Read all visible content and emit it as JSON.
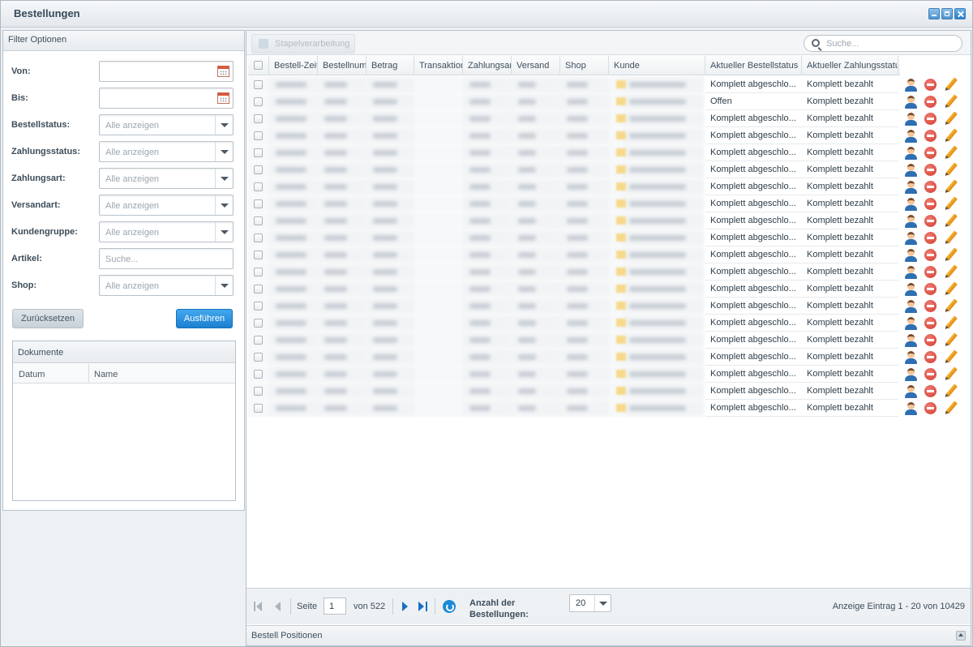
{
  "window": {
    "title": "Bestellungen"
  },
  "filter": {
    "header": "Filter Optionen",
    "fields": [
      {
        "label": "Von:",
        "type": "date",
        "value": ""
      },
      {
        "label": "Bis:",
        "type": "date",
        "value": ""
      },
      {
        "label": "Bestellstatus:",
        "type": "select",
        "value": "Alle anzeigen"
      },
      {
        "label": "Zahlungsstatus:",
        "type": "select",
        "value": "Alle anzeigen"
      },
      {
        "label": "Zahlungsart:",
        "type": "select",
        "value": "Alle anzeigen"
      },
      {
        "label": "Versandart:",
        "type": "select",
        "value": "Alle anzeigen"
      },
      {
        "label": "Kundengruppe:",
        "type": "select",
        "value": "Alle anzeigen"
      },
      {
        "label": "Artikel:",
        "type": "text",
        "value": "Suche..."
      },
      {
        "label": "Shop:",
        "type": "select",
        "value": "Alle anzeigen"
      }
    ],
    "reset_label": "Zurücksetzen",
    "run_label": "Ausführen"
  },
  "documents": {
    "header": "Dokumente",
    "columns": [
      "Datum",
      "Name"
    ]
  },
  "toolbar": {
    "batch_label": "Stapelverarbeitung",
    "search_placeholder": "Suche..."
  },
  "grid": {
    "columns": [
      "Bestell-Zeit",
      "Bestellnummer",
      "Betrag",
      "Transaktion",
      "Zahlungsart",
      "Versand",
      "Shop",
      "Kunde",
      "Aktueller Bestellstatus",
      "Aktueller Zahlungsstatus"
    ],
    "rows": [
      {
        "order_status": "Komplett abgeschlo...",
        "payment_status": "Komplett bezahlt"
      },
      {
        "order_status": "Offen",
        "payment_status": "Komplett bezahlt"
      },
      {
        "order_status": "Komplett abgeschlo...",
        "payment_status": "Komplett bezahlt"
      },
      {
        "order_status": "Komplett abgeschlo...",
        "payment_status": "Komplett bezahlt"
      },
      {
        "order_status": "Komplett abgeschlo...",
        "payment_status": "Komplett bezahlt"
      },
      {
        "order_status": "Komplett abgeschlo...",
        "payment_status": "Komplett bezahlt"
      },
      {
        "order_status": "Komplett abgeschlo...",
        "payment_status": "Komplett bezahlt"
      },
      {
        "order_status": "Komplett abgeschlo...",
        "payment_status": "Komplett bezahlt"
      },
      {
        "order_status": "Komplett abgeschlo...",
        "payment_status": "Komplett bezahlt"
      },
      {
        "order_status": "Komplett abgeschlo...",
        "payment_status": "Komplett bezahlt"
      },
      {
        "order_status": "Komplett abgeschlo...",
        "payment_status": "Komplett bezahlt"
      },
      {
        "order_status": "Komplett abgeschlo...",
        "payment_status": "Komplett bezahlt"
      },
      {
        "order_status": "Komplett abgeschlo...",
        "payment_status": "Komplett bezahlt"
      },
      {
        "order_status": "Komplett abgeschlo...",
        "payment_status": "Komplett bezahlt"
      },
      {
        "order_status": "Komplett abgeschlo...",
        "payment_status": "Komplett bezahlt"
      },
      {
        "order_status": "Komplett abgeschlo...",
        "payment_status": "Komplett bezahlt"
      },
      {
        "order_status": "Komplett abgeschlo...",
        "payment_status": "Komplett bezahlt"
      },
      {
        "order_status": "Komplett abgeschlo...",
        "payment_status": "Komplett bezahlt"
      },
      {
        "order_status": "Komplett abgeschlo...",
        "payment_status": "Komplett bezahlt"
      },
      {
        "order_status": "Komplett abgeschlo...",
        "payment_status": "Komplett bezahlt"
      }
    ],
    "row_action_icons": [
      "user-icon",
      "delete-icon",
      "edit-icon"
    ]
  },
  "paging": {
    "page_label": "Seite",
    "page": "1",
    "of_label": "von 522",
    "per_page_label": "Anzahl der Bestellungen:",
    "per_page_value": "20",
    "summary": "Anzeige Eintrag 1 - 20 von 10429"
  },
  "bottom_panel": {
    "title": "Bestell Positionen"
  },
  "colors": {
    "accent": "#1b7fcf",
    "delete": "#d23a2f",
    "edit": "#f0a020"
  }
}
